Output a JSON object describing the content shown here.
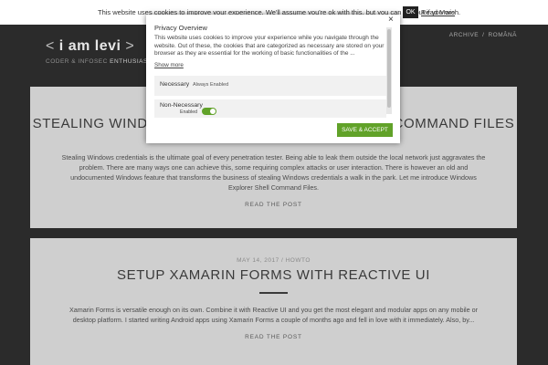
{
  "cookie_bar": {
    "text": "This website uses cookies to improve your experience. We'll assume you're ok with this, but you can opt-out if you wish.",
    "ok_label": "OK",
    "read_more_label": "Read More"
  },
  "header": {
    "logo_prefix": "< ",
    "logo_name": "i am levi",
    "logo_suffix": " >",
    "tagline_prefix": "CODER & INFOSEC ",
    "tagline_highlight": "ENTHUSIAST",
    "nav": [
      {
        "label": "ARCHIVE"
      },
      {
        "label": "ROMÂNĂ"
      }
    ],
    "nav_separator": "/"
  },
  "posts": [
    {
      "meta": "",
      "title": "STEALING WINDOWS CREDENTIALS USING SHELL COMMAND FILES",
      "excerpt": "Stealing Windows credentials is the ultimate goal of every penetration tester. Being able to leak them outside the local network just aggravates the problem. There are many ways one can achieve this, some requiring complex attacks or user interaction. There is however an old and undocumented Windows feature that transforms the business of stealing Windows credentials a walk in the park. Let me introduce Windows Explorer Shell Command Files.",
      "read_more": "READ THE POST"
    },
    {
      "meta": "MAY 14, 2017 / HOWTO",
      "title": "SETUP XAMARIN FORMS WITH REACTIVE UI",
      "excerpt": "Xamarin Forms is versatile enough on its own. Combine it with Reactive UI and you get the most elegant and modular apps on any mobile or desktop platform. I started writing Android apps using Xamarin Forms a couple of months ago and fell in love with it immediately. Also, by...",
      "read_more": "READ THE POST"
    }
  ],
  "privacy_modal": {
    "title": "Privacy Overview",
    "close_label": "×",
    "body": "This website uses cookies to improve your experience while you navigate through the website. Out of these, the cookies that are categorized as necessary are stored on your browser as they are essential for the working of basic functionalities of the ...",
    "show_more": "Show more",
    "necessary_label": "Necessary",
    "necessary_status": "Always Enabled",
    "non_necessary_label": "Non-Necessary",
    "non_necessary_status": "Enabled",
    "non_necessary_enabled": true,
    "save_label": "SAVE & ACCEPT",
    "accent_color": "#61a229"
  }
}
